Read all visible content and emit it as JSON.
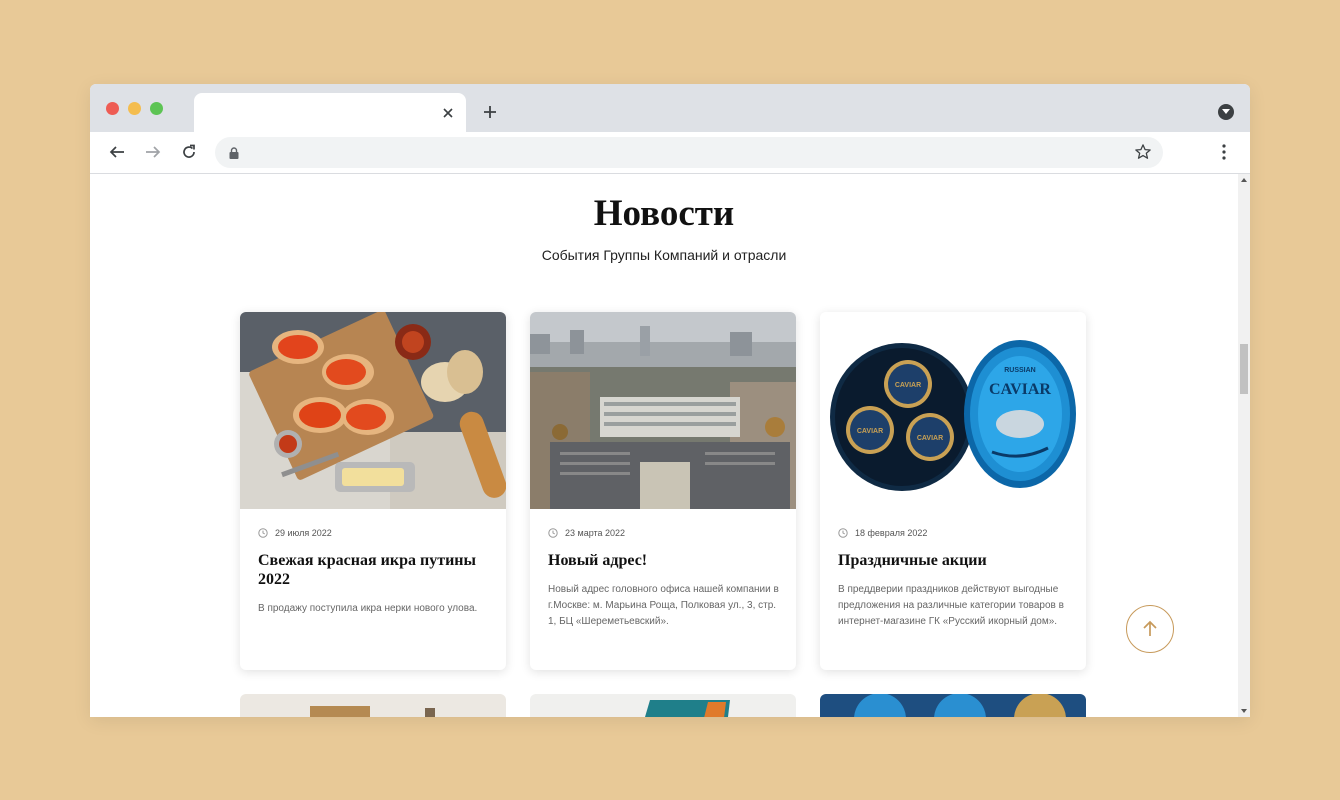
{
  "browser": {
    "tab_title": "",
    "address": "",
    "colors": {
      "frame": "#dee1e6",
      "accent": "#c79a5b",
      "background": "#e8c997"
    }
  },
  "page": {
    "title": "Новости",
    "subtitle": "События Группы Компаний и отрасли"
  },
  "news": [
    {
      "date": "29 июля 2022",
      "title": "Свежая красная икра путины 2022",
      "text": "В продажу поступила икра нерки нового улова.",
      "image": "red-caviar-sandwiches-image"
    },
    {
      "date": "23 марта 2022",
      "title": "Новый адрес!",
      "text": "Новый адрес головного офиса нашей компании в г.Москве: м. Марьина Роща, Полковая ул., 3, стр. 1, БЦ «Шереметьевский».",
      "image": "office-building-aerial-image"
    },
    {
      "date": "18 февраля 2022",
      "title": "Праздничные акции",
      "text": "В преддверии праздников действуют выгодные предложения на различные категории товаров в интернет-магазине ГК «Русский икорный дом».",
      "image": "caviar-tins-image"
    }
  ],
  "tin_labels": {
    "brand": "CAVIAR",
    "top": "RUSSIAN"
  }
}
